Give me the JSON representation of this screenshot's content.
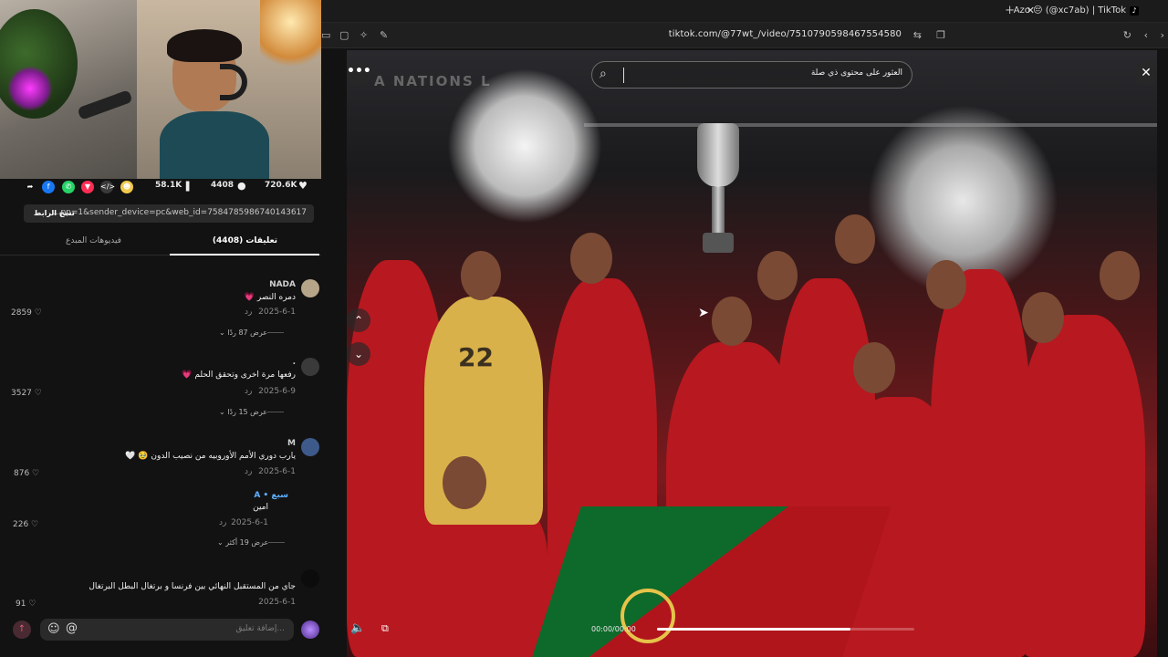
{
  "browser": {
    "tab_title": "Azo 😔 (@xc7ab) | TikTok",
    "tab_favicon": "♪",
    "url": "tiktok.com/@77wt_/video/7510790598467554580"
  },
  "sidebar": {
    "stats": {
      "likes": "720.6K",
      "comments": "4408",
      "saves": "58.1K"
    },
    "share_colors": {
      "facebook": "#1877f2",
      "whatsapp": "#25d366",
      "pinterest": "#ff2d55",
      "embed": "#3a3a3a",
      "friends": "#f2c94c"
    },
    "copy_link": {
      "button_label": "نسخ الرابط",
      "url": "...pp=1&sender_device=pc&web_id=7584785986740143617"
    },
    "tabs": {
      "comments": "تعليقات (4408)",
      "creator_videos": "فيديوهات المبدع"
    },
    "comments": [
      {
        "author": "NADA",
        "text": "دمره النصر 💗",
        "date": "2025-6-1",
        "reply": "رد",
        "likes": "2859",
        "view_replies": "عرض 87 ردًا"
      },
      {
        "author": ".",
        "text": "رفعها مرة اخرى وتحقق الحلم 💗",
        "date": "2025-6-9",
        "reply": "رد",
        "likes": "3527",
        "view_replies": "عرض 15 ردًا"
      },
      {
        "author": "M",
        "text": "يارب دوري الأمم الأوروبيه من نصيب الدون 🥹 🤍",
        "date": "2025-6-1",
        "reply": "رد",
        "likes": "876"
      },
      {
        "author": "A • سبع",
        "text": "امين",
        "date": "2025-6-1",
        "reply": "رد",
        "likes": "226",
        "view_replies": "عرض 19 أكثر"
      },
      {
        "author": "",
        "text": "جاي من المستقبل النهائي بين فرنسا و برتغال البطل البرتغال",
        "date": "2025-6-1",
        "likes": "91"
      }
    ],
    "input": {
      "placeholder": "إضافة تعليق...",
      "emoji_icon": "☺",
      "mention_icon": "@"
    }
  },
  "video": {
    "search_placeholder": "العثور على محتوى ذي صلة",
    "banner_text": "A NATIONS L",
    "keeper_number": "22",
    "timecode": "00:00/00:00",
    "progress": 0.75
  }
}
